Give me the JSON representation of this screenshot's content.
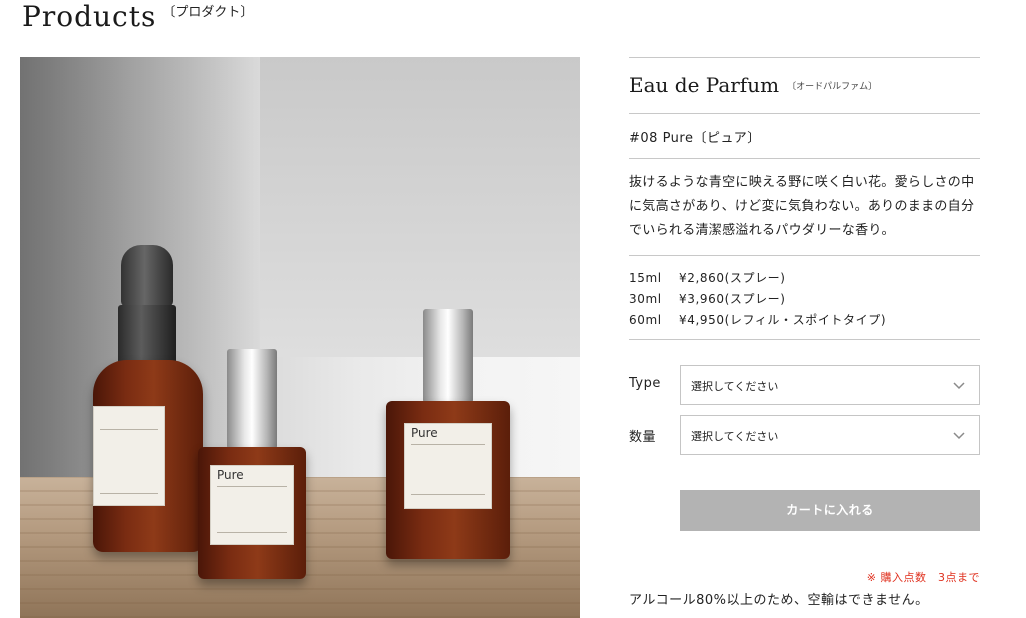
{
  "page": {
    "title_en": "Products",
    "title_jp": "〔プロダクト〕"
  },
  "photo": {
    "label_text": "Pure"
  },
  "product": {
    "name_en": "Eau de Parfum",
    "name_jp": "〔オードパルファム〕",
    "variant": "#08 Pure〔ピュア〕",
    "description": "抜けるような青空に映える野に咲く白い花。愛らしさの中に気高さがあり、けど変に気負わない。ありのままの自分でいられる清潔感溢れるパウダリーな香り。",
    "prices": [
      {
        "volume": "15ml",
        "price": "¥2,860(スプレー)"
      },
      {
        "volume": "30ml",
        "price": "¥3,960(スプレー)"
      },
      {
        "volume": "60ml",
        "price": "¥4,950(レフィル・スポイトタイプ)"
      }
    ]
  },
  "form": {
    "type_label": "Type",
    "type_value": "選択してください",
    "qty_label": "数量",
    "qty_value": "選択してください",
    "cart_button": "カートに入れる",
    "limit_note": "※ 購入点数　3点まで",
    "shipping_note": "アルコール80%以上のため、空輸はできません。"
  },
  "colors": {
    "accent_red": "#e0301e",
    "button_gray": "#b3b3b3",
    "rule_gray": "#c8c8c8"
  }
}
